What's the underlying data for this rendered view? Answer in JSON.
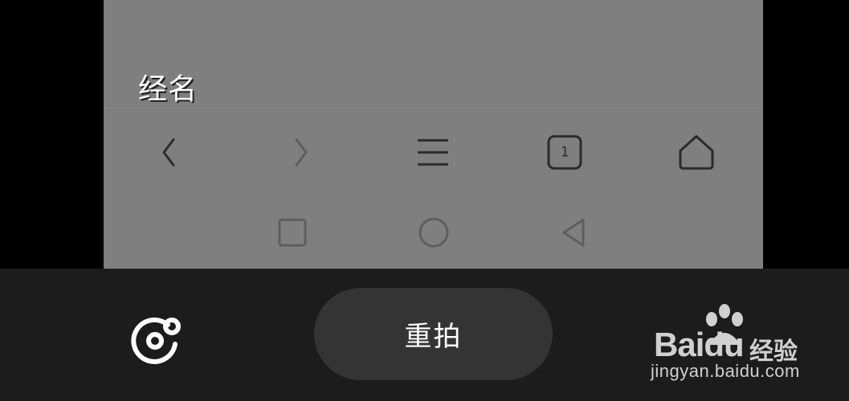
{
  "preview": {
    "page_label": "经名",
    "browser_nav": {
      "tab_count": "1",
      "icons": [
        "back-arrow-icon",
        "forward-arrow-icon",
        "menu-icon",
        "tabs-icon",
        "home-icon"
      ]
    },
    "system_nav": {
      "icons": [
        "recent-apps-icon",
        "home-circle-icon",
        "back-triangle-icon"
      ]
    }
  },
  "bottom_bar": {
    "retake_label": "重拍",
    "effect_icon": "filter-effect-icon"
  },
  "watermark": {
    "brand": "Baidu",
    "product": "经验",
    "url": "jingyan.baidu.com"
  },
  "colors": {
    "preview_bg": "#7f7f7f",
    "bar_bg": "#1c1c1c",
    "button_bg": "#343434"
  }
}
